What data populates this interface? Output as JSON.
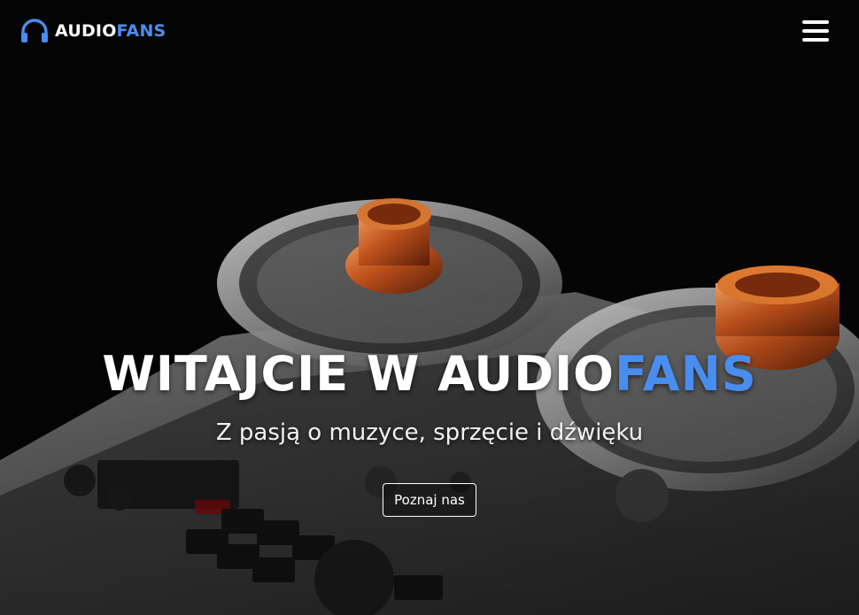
{
  "brand": {
    "name_part1": "AUDIO",
    "name_part2": "FANS"
  },
  "hero": {
    "title_part1": "WITAJCIE W AUDIO",
    "title_part2": "FANS",
    "subtitle": "Z pasją o muzyce, sprzęcie i dźwięku",
    "cta_label": "Poznaj nas"
  },
  "colors": {
    "accent": "#4a8df0",
    "text": "#ffffff",
    "background": "#050505"
  },
  "icons": {
    "logo": "headphones-icon",
    "menu": "hamburger-menu-icon"
  }
}
